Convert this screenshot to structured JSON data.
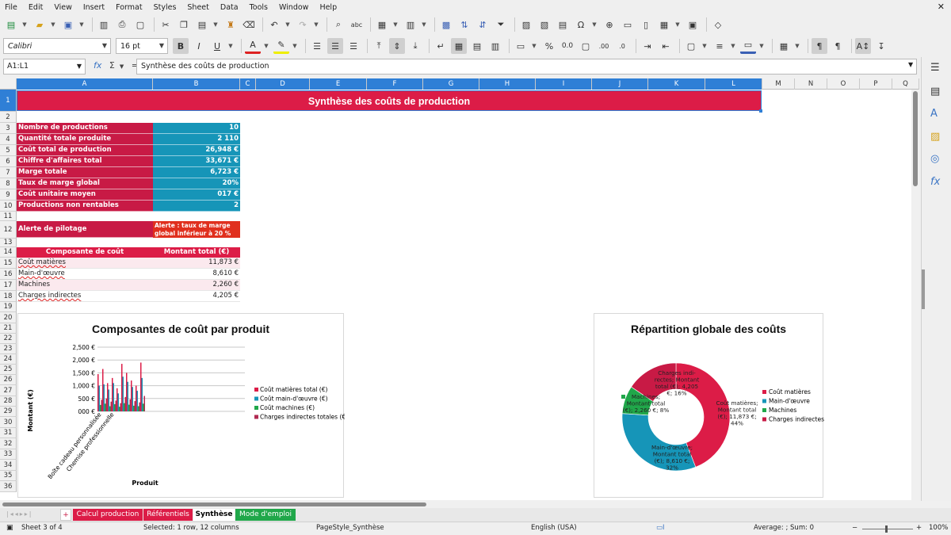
{
  "menu": [
    "File",
    "Edit",
    "View",
    "Insert",
    "Format",
    "Styles",
    "Sheet",
    "Data",
    "Tools",
    "Window",
    "Help"
  ],
  "toolbar": {
    "font_name": "Calibri",
    "font_size": "16 pt"
  },
  "formula_bar": {
    "name_box": "A1:L1",
    "content": "Synthèse des coûts de production"
  },
  "columns": [
    "A",
    "B",
    "C",
    "D",
    "E",
    "F",
    "G",
    "H",
    "I",
    "J",
    "K",
    "L",
    "M",
    "N",
    "O",
    "P",
    "Q"
  ],
  "rows": [
    "1",
    "2",
    "3",
    "4",
    "5",
    "6",
    "7",
    "8",
    "9",
    "10",
    "11",
    "12",
    "13",
    "14",
    "15",
    "16",
    "17",
    "18",
    "19",
    "20",
    "21",
    "22",
    "23",
    "24",
    "25",
    "26",
    "27",
    "28",
    "29",
    "30",
    "31",
    "32",
    "33",
    "34",
    "35",
    "36"
  ],
  "sheet": {
    "title": "Synthèse des coûts de production",
    "kpis": [
      {
        "label": "Nombre de productions",
        "value": "10"
      },
      {
        "label": "Quantité totale produite",
        "value": "2 110"
      },
      {
        "label": "Coût total de production",
        "value": "26,948 €"
      },
      {
        "label": "Chiffre d'affaires total",
        "value": "33,671 €"
      },
      {
        "label": "Marge totale",
        "value": "6,723 €"
      },
      {
        "label": "Taux de marge global",
        "value": "20%"
      },
      {
        "label": "Coût unitaire moyen",
        "value": "017 €"
      },
      {
        "label": "Productions non rentables",
        "value": "2"
      }
    ],
    "alert": {
      "label": "Alerte de pilotage",
      "value": "Alerte : taux de marge global inférieur à 20 %"
    },
    "cost_table": {
      "headers": [
        "Composante de coût",
        "Montant total (€)"
      ],
      "rows": [
        {
          "name": "Coût matières",
          "amount": "11,873 €"
        },
        {
          "name": "Main-d'œuvre",
          "amount": "8,610 €"
        },
        {
          "name": "Machines",
          "amount": "2,260 €"
        },
        {
          "name": "Charges indirectes",
          "amount": "4,205 €"
        }
      ]
    }
  },
  "chart_data": [
    {
      "type": "bar",
      "title": "Composantes de coût par produit",
      "xlabel": "Produit",
      "ylabel": "Montant (€)",
      "ylim": [
        0,
        2500
      ],
      "yticks": [
        "2,500 €",
        "2,000 €",
        "1,500 €",
        "1,000 €",
        "500 €",
        "000 €"
      ],
      "categories": [
        "Boîte cadeau personnalisée",
        "Chemise professionnelle"
      ],
      "series": [
        {
          "name": "Coût matières total (€)",
          "color": "#dc1c47",
          "values": [
            1450,
            1650,
            1100,
            1300,
            900,
            1850,
            1500,
            1200,
            1000,
            1900
          ]
        },
        {
          "name": "Coût main-d'œuvre (€)",
          "color": "#1695b8",
          "values": [
            1000,
            1050,
            850,
            1100,
            700,
            1350,
            1150,
            950,
            800,
            1300
          ]
        },
        {
          "name": "Coût machines (€)",
          "color": "#20a74a",
          "values": [
            250,
            300,
            200,
            280,
            180,
            320,
            260,
            220,
            200,
            300
          ]
        },
        {
          "name": "Charges indirectes totales (€)",
          "color": "#b02a52",
          "values": [
            450,
            500,
            380,
            420,
            320,
            560,
            470,
            400,
            350,
            600
          ]
        }
      ],
      "legend": "right"
    },
    {
      "type": "pie",
      "donut": true,
      "title": "Répartition globale des coûts",
      "slices": [
        {
          "name": "Coût matières",
          "value": 11873,
          "color": "#dc1c47",
          "label": [
            "Coût matières;",
            "Montant total",
            "(€); 11,873 €;",
            "44%"
          ]
        },
        {
          "name": "Main-d'œuvre",
          "value": 8610,
          "color": "#1695b8",
          "label": [
            "Main-d'œuvre;",
            "Montant total",
            "(€); 8,610 €;",
            "32%"
          ]
        },
        {
          "name": "Machines",
          "value": 2260,
          "color": "#20a74a",
          "label": [
            "Machines;",
            "Montant total",
            "(€); 2,260 €; 8%"
          ]
        },
        {
          "name": "Charges indirectes",
          "value": 4205,
          "color": "#c81a45",
          "label": [
            "Charges indi-",
            "rectes; Montant",
            "total (€); 4,205",
            "€; 16%"
          ]
        }
      ],
      "legend": "right"
    }
  ],
  "tabs": [
    "Calcul production",
    "Référentiels",
    "Synthèse",
    "Mode d'emploi"
  ],
  "status": {
    "sheet": "Sheet 3 of 4",
    "selection": "Selected: 1 row, 12 columns",
    "page_style": "PageStyle_Synthèse",
    "language": "English (USA)",
    "sum": "Average: ; Sum: 0",
    "zoom": "100%"
  },
  "colors": {
    "label_bg": "#c81a45",
    "value_bg": "#1695b8",
    "selection": "#2f7fd6",
    "green": "#20a74a"
  }
}
